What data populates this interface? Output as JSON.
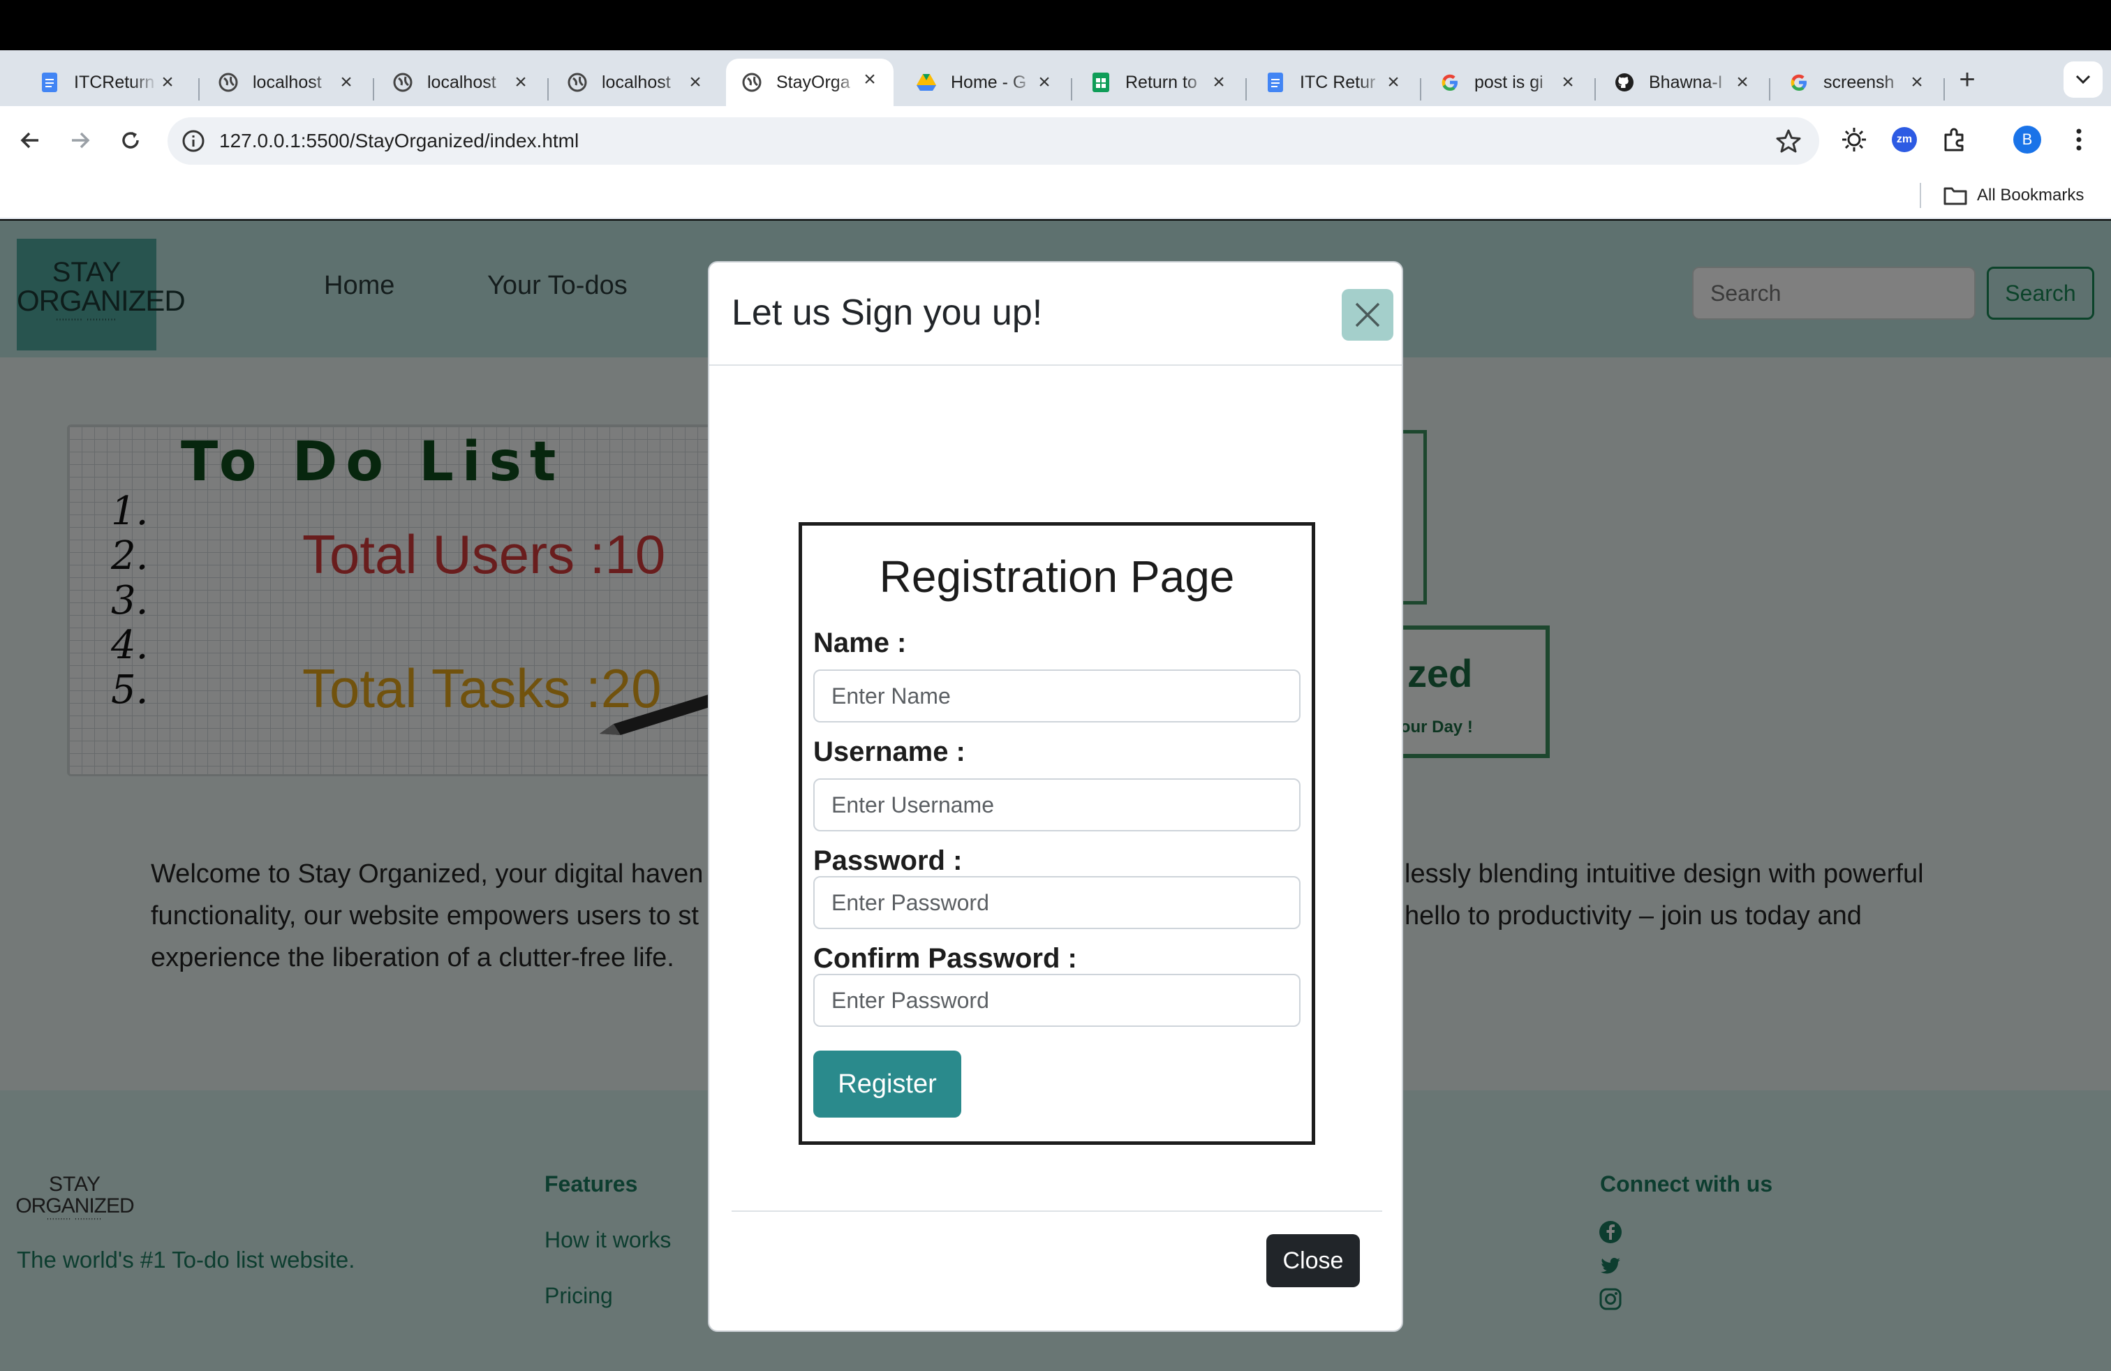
{
  "browser": {
    "tabs": [
      {
        "label": "ITCReturn",
        "favicon": "docs-icon"
      },
      {
        "label": "localhost",
        "favicon": "globe-icon"
      },
      {
        "label": "localhost",
        "favicon": "globe-icon"
      },
      {
        "label": "localhost",
        "favicon": "globe-icon"
      },
      {
        "label": "StayOrga",
        "favicon": "globe-icon",
        "active": true
      },
      {
        "label": "Home - G",
        "favicon": "drive-icon"
      },
      {
        "label": "Return to",
        "favicon": "sheets-icon"
      },
      {
        "label": "ITC Retur",
        "favicon": "docs-icon"
      },
      {
        "label": "post is gi",
        "favicon": "google-icon"
      },
      {
        "label": "Bhawna-I",
        "favicon": "github-icon"
      },
      {
        "label": "screensh",
        "favicon": "google-icon"
      }
    ],
    "url": "127.0.0.1:5500/StayOrganized/index.html",
    "profile_initial": "B",
    "extension_label": "zm",
    "bookmarks_label": "All Bookmarks"
  },
  "site": {
    "logo_line1": "STAY",
    "logo_line2": "ORGANIZED",
    "nav": [
      "Home",
      "Your To-dos"
    ],
    "search_placeholder": "Search",
    "search_button": "Search",
    "hero": {
      "title": "To Do List",
      "numbers": [
        "1.",
        "2.",
        "3.",
        "4.",
        "5."
      ],
      "total_users": "Total Users :10",
      "total_tasks": "Total Tasks :20"
    },
    "brand_title": "zed",
    "brand_subtitle": "r Your Day !",
    "welcome_lines": [
      "Welcome to Stay Organized, your digital haven",
      "functionality, our website empowers users to st",
      "experience the liberation of a clutter-free life.",
      "lessly blending intuitive design with powerful",
      "hello to productivity – join us today and"
    ],
    "footer": {
      "tagline": "The world's #1 To-do list website.",
      "features_heading": "Features",
      "features_links": [
        "How it works",
        "Pricing"
      ],
      "connect_heading": "Connect with us",
      "social_icons": [
        "facebook-icon",
        "twitter-icon",
        "instagram-icon"
      ]
    }
  },
  "modal": {
    "title": "Let us Sign you up!",
    "form_title": "Registration Page",
    "fields": [
      {
        "label": "Name :",
        "placeholder": "Enter Name"
      },
      {
        "label": "Username :",
        "placeholder": "Enter Username"
      },
      {
        "label": "Password :",
        "placeholder": "Enter Password"
      },
      {
        "label": "Confirm Password :",
        "placeholder": "Enter Password"
      }
    ],
    "register_button": "Register",
    "close_button": "Close"
  },
  "colors": {
    "accent": "#2a8a8c",
    "nav_bg": "#bde3df",
    "footer_text": "#1a7a5e",
    "users_red": "#d33a3a",
    "tasks_gold": "#e2a41a"
  }
}
